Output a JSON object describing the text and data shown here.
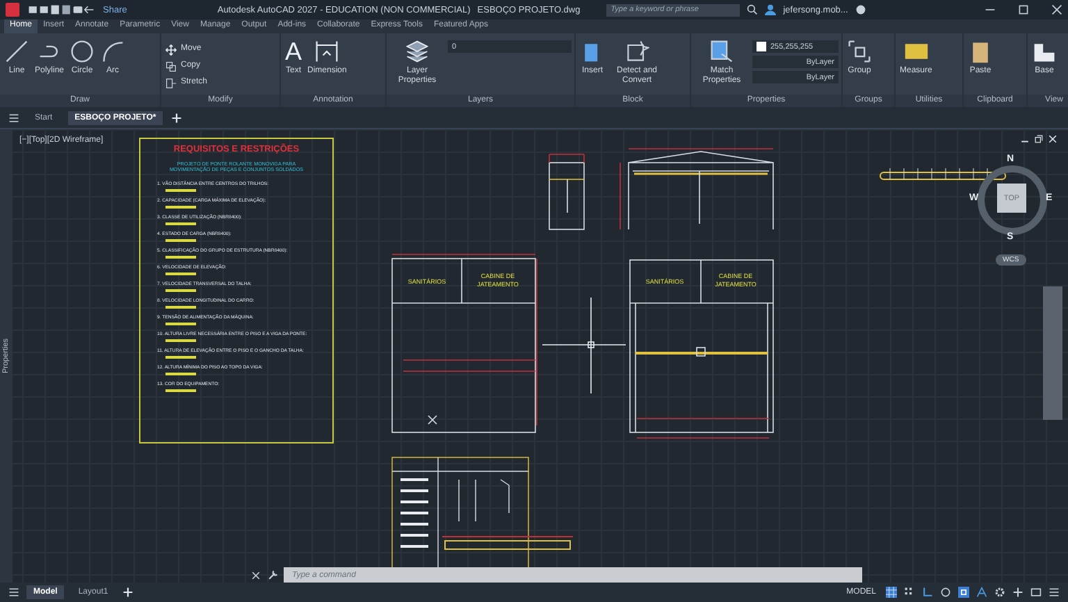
{
  "window": {
    "title": "Autodesk AutoCAD 2027 - EDUCATION (NON COMMERCIAL)",
    "file": "ESBOÇO PROJETO.dwg",
    "share": "Share",
    "search": {
      "placeholder": "Type a keyword or phrase"
    },
    "user": "jefersong.mob..."
  },
  "ribbon_tabs": [
    {
      "label": "Home",
      "selected": true
    },
    {
      "label": "Insert",
      "selected": false
    },
    {
      "label": "Annotate",
      "selected": false
    },
    {
      "label": "Parametric",
      "selected": false
    },
    {
      "label": "View",
      "selected": false
    },
    {
      "label": "Manage",
      "selected": false
    },
    {
      "label": "Output",
      "selected": false
    },
    {
      "label": "Add-ins",
      "selected": false
    },
    {
      "label": "Collaborate",
      "selected": false
    },
    {
      "label": "Express Tools",
      "selected": false
    },
    {
      "label": "Featured Apps",
      "selected": false
    }
  ],
  "panels": [
    {
      "title": "Draw",
      "tools": [
        {
          "label": "Line",
          "kind": "large"
        },
        {
          "label": "Polyline",
          "kind": "large"
        },
        {
          "label": "Circle",
          "kind": "large"
        },
        {
          "label": "Arc",
          "kind": "large"
        }
      ]
    },
    {
      "title": "Modify",
      "tools": [
        {
          "label": "Move",
          "kind": "small"
        },
        {
          "label": "Copy",
          "kind": "small"
        },
        {
          "label": "Stretch",
          "kind": "small"
        }
      ]
    },
    {
      "title": "Annotation",
      "tools": [
        {
          "label": "Text",
          "glyph": "A",
          "kind": "large"
        },
        {
          "label": "Dimension",
          "kind": "large"
        }
      ]
    },
    {
      "title": "Layers",
      "tools": [
        {
          "label": "Layer Properties",
          "kind": "large"
        }
      ],
      "dropdowns": [
        {
          "value": "0"
        }
      ]
    },
    {
      "title": "Block",
      "tools": [
        {
          "label": "Insert",
          "kind": "large"
        },
        {
          "label": "Detect and Convert",
          "kind": "large"
        }
      ]
    },
    {
      "title": "Properties",
      "tools": [
        {
          "label": "Match Properties",
          "kind": "large"
        }
      ],
      "dropdowns": [
        {
          "value": "255,255,255",
          "color": "#ffffff"
        },
        {
          "value": "ByLayer"
        },
        {
          "value": "ByLayer"
        }
      ]
    },
    {
      "title": "Groups",
      "tools": [
        {
          "label": "Group",
          "kind": "large"
        }
      ]
    },
    {
      "title": "Utilities",
      "tools": [
        {
          "label": "Measure",
          "kind": "large"
        }
      ]
    },
    {
      "title": "Clipboard",
      "tools": [
        {
          "label": "Paste",
          "kind": "large"
        }
      ]
    },
    {
      "title": "View",
      "tools": [
        {
          "label": "Base",
          "kind": "large"
        }
      ]
    }
  ],
  "file_tabs": [
    {
      "label": "Start",
      "selected": false
    },
    {
      "label": "ESBOÇO PROJETO*",
      "selected": true
    }
  ],
  "viewport": {
    "label": "[−][Top][2D Wireframe]",
    "palette": "Properties"
  },
  "sheet": {
    "title": "REQUISITOS E RESTRIÇÕES",
    "subtitle": "PROJETO DE PONTE ROLANTE MONOVIGA PARA MOVIMENTAÇÃO DE PEÇAS E CONJUNTOS SOLDADOS",
    "items": [
      "1. VÃO DISTÂNCIA ENTRE CENTROS DO TRILHOS:",
      "2. CAPACIDADE (CARGA MÁXIMA DE ELEVAÇÃO):",
      "3. CLASSE DE UTILIZAÇÃO (NBR8400):",
      "4. ESTADO DE CARGA (NBR8400):",
      "5. CLASSIFICAÇÃO DO GRUPO DE ESTRUTURA (NBR8400):",
      "6. VELOCIDADE DE ELEVAÇÃO:",
      "7. VELOCIDADE TRANSVERSAL DO TALHA:",
      "8. VELOCIDADE LONGITUDINAL DO CARRO:",
      "9. TENSÃO DE ALIMENTAÇÃO DA MÁQUINA:",
      "10. ALTURA LIVRE NECESSÁRIA ENTRE O PISO E A VIGA DA PONTE:",
      "11. ALTURA DE ELEVAÇÃO ENTRE O PISO E O GANCHO DA TALHA:",
      "12. ALTURA MÍNIMA DO PISO AO TOPO DA VIGA:",
      "13. COR DO EQUIPAMENTO:"
    ]
  },
  "plans": [
    {
      "rooms": [
        "SANITÁRIOS",
        "CABINE DE JATEAMENTO"
      ]
    },
    {
      "rooms": [
        "SANITÁRIOS",
        "CABINE DE JATEAMENTO"
      ]
    }
  ],
  "viewcube": {
    "north": "N",
    "south": "S",
    "east": "E",
    "west": "W",
    "face": "TOP",
    "ucs": "WCS"
  },
  "command": {
    "placeholder": "Type a command"
  },
  "layout_tabs": [
    {
      "label": "Model",
      "selected": true
    },
    {
      "label": "Layout1",
      "selected": false
    }
  ],
  "status": {
    "space": "MODEL"
  }
}
